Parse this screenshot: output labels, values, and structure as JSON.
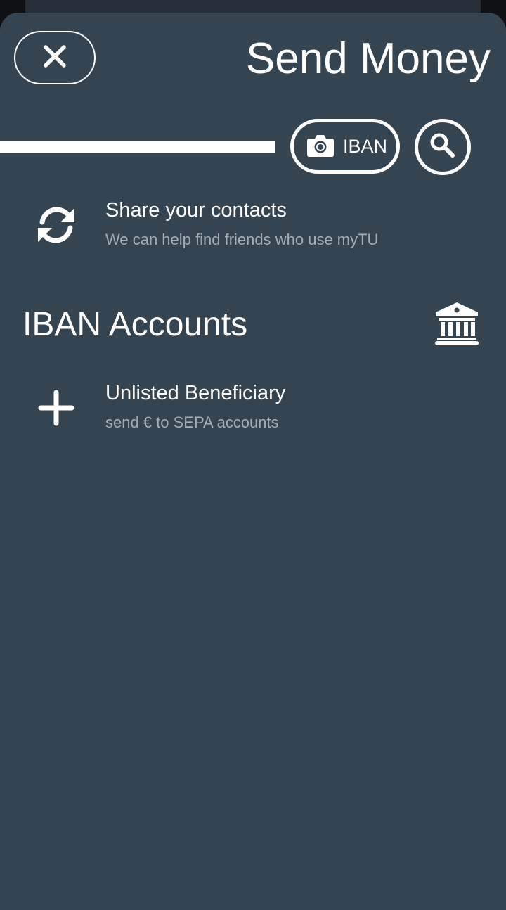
{
  "header": {
    "title": "Send Money"
  },
  "search": {
    "iban_button_label": "IBAN"
  },
  "share_contacts": {
    "title": "Share your contacts",
    "subtitle": "We can help find friends who use myTU"
  },
  "iban_section": {
    "title": "IBAN Accounts"
  },
  "unlisted_beneficiary": {
    "title": "Unlisted Beneficiary",
    "subtitle": "send € to SEPA accounts"
  },
  "icons": {
    "close": "close-icon",
    "camera": "camera-icon",
    "search": "search-icon",
    "sync": "sync-icon",
    "bank": "bank-icon",
    "plus": "plus-icon"
  },
  "colors": {
    "sheet_background": "#354451",
    "secondary_text": "#a3adb6",
    "foreground": "#ffffff"
  }
}
